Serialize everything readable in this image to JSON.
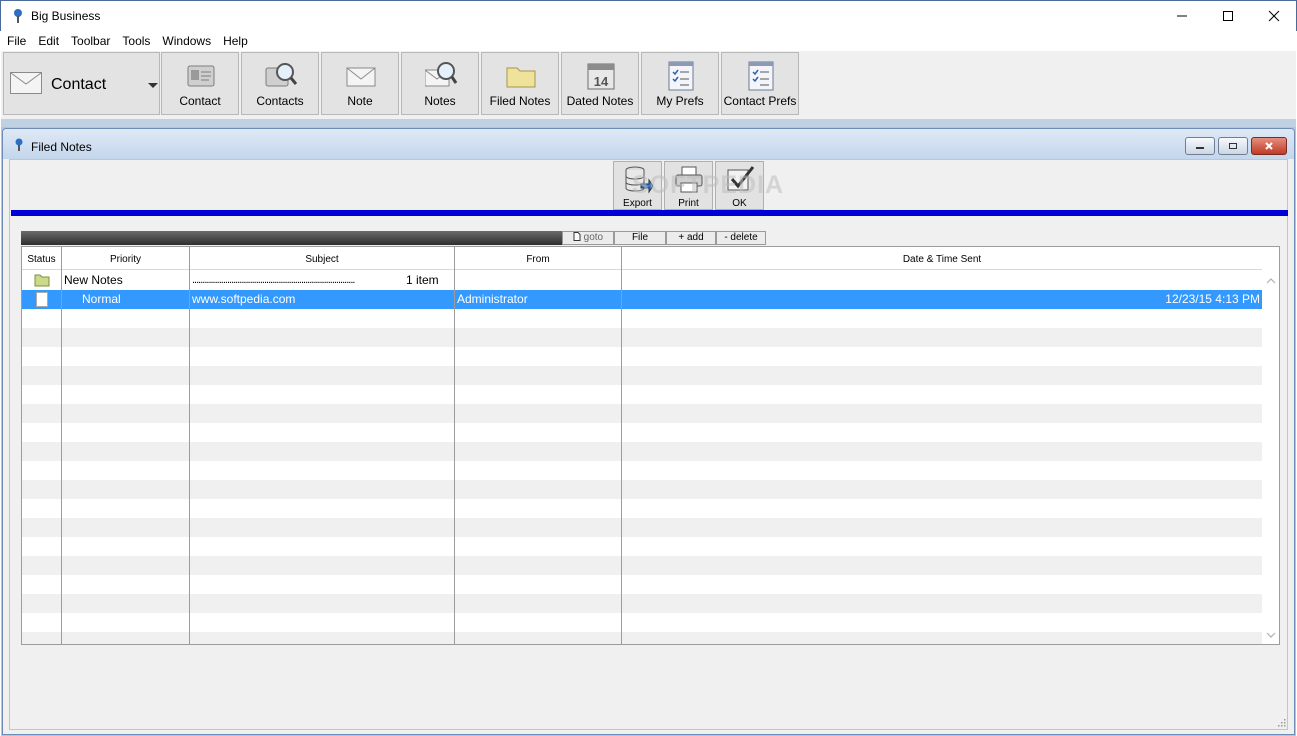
{
  "window": {
    "title": "Big Business"
  },
  "menu": [
    "File",
    "Edit",
    "Toolbar",
    "Tools",
    "Windows",
    "Help"
  ],
  "toolbar": {
    "combo_label": "Contact",
    "buttons": [
      "Contact",
      "Contacts",
      "Note",
      "Notes",
      "Filed Notes",
      "Dated Notes",
      "My Prefs",
      "Contact Prefs"
    ],
    "calendar_day": "14"
  },
  "child": {
    "title": "Filed Notes",
    "actions": [
      "Export",
      "Print",
      "OK"
    ],
    "watermark": "SOFTPEDIA"
  },
  "tabs": {
    "goto": "goto",
    "file": "File",
    "add": "+ add",
    "delete": "- delete"
  },
  "grid": {
    "columns": [
      "Status",
      "Priority",
      "Subject",
      "From",
      "Date & Time Sent"
    ],
    "group": {
      "name": "New Notes",
      "dots": "...............................................................................",
      "count": "1 item"
    },
    "rows": [
      {
        "priority": "Normal",
        "subject": "www.softpedia.com",
        "from": "Administrator",
        "date": "12/23/15 4:13 PM"
      }
    ]
  }
}
